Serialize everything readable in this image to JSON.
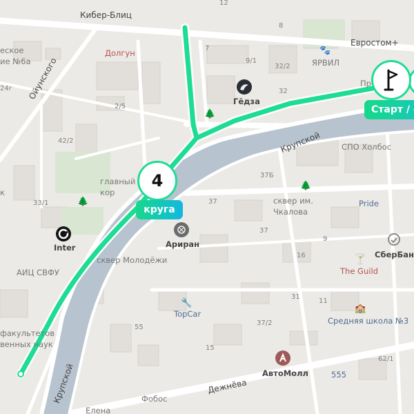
{
  "map": {
    "streets": {
      "kiber_blits": "Кибер-Блиц",
      "oyunskogo": "Ойунского",
      "krupskoy_top": "Крупской",
      "krupskoy_bottom": "Крупской",
      "dezhneva": "Дежнёва",
      "evrostom": "Евростом+"
    },
    "places": {
      "dolgun": "Долгун",
      "gedza": "Гёдза",
      "yarvil": "ЯРВИЛ",
      "spo_kholbos": "СПО Холбос",
      "glavny_kor": "главный\nкор",
      "skver_chkalova": "сквер им.\nЧкалова",
      "pride": "Pride",
      "sberbank": "СберБанк",
      "the_guild": "The Guild",
      "inter": "Inter",
      "arirang": "Ариран",
      "skver_molodezhi": "сквер Молодёжи",
      "aits_svfu": "АИЦ СВФУ",
      "fakultet": "факультетов\nвенных наук",
      "topcar": "TopCar",
      "school3": "Средняя школа №3",
      "avtomoll": "АвтоМолл",
      "fobos": "Фобос",
      "elena": "Елена",
      "echeskoe": "еское\nие №6а",
      "k_left": "к",
      "pr": "Пр",
      "n555": "555"
    },
    "house_numbers": [
      "12",
      "8",
      "7",
      "9/1",
      "32/2",
      "32",
      "24г",
      "2/5",
      "42/2",
      "33/1",
      "37Б",
      "37",
      "37",
      "9",
      "16",
      "31",
      "11",
      "37/2",
      "55",
      "15",
      "62/1"
    ],
    "route": {
      "laps_value": "4",
      "laps_label": "круга",
      "start_label": "Старт / ф",
      "color": "#1fdc94"
    },
    "icons": [
      "flag-icon",
      "restaurant-icon",
      "pet-icon",
      "sushi-icon",
      "tree-icon",
      "bank-icon",
      "cocktail-icon",
      "car-icon",
      "school-icon",
      "mall-icon",
      "food-icon"
    ]
  }
}
